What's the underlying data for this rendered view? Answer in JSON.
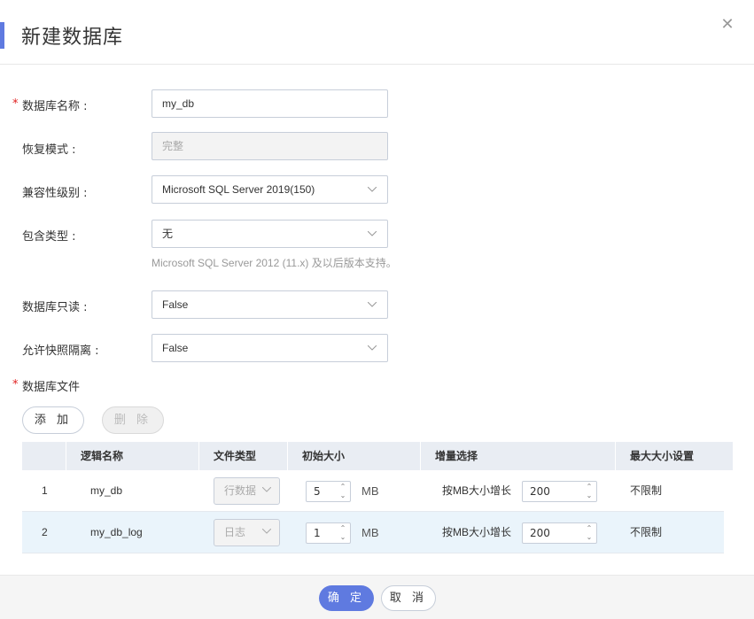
{
  "dialog": {
    "title": "新建数据库",
    "close_glyph": "✕"
  },
  "form": {
    "db_name": {
      "label": "数据库名称 :",
      "required_mark": "*",
      "value": "my_db"
    },
    "recovery_mode": {
      "label": "恢复模式 :",
      "value": "完整"
    },
    "compat_level": {
      "label": "兼容性级别 :",
      "value": "Microsoft SQL Server 2019(150)"
    },
    "containment": {
      "label": "包含类型 :",
      "value": "无",
      "hint": "Microsoft SQL Server 2012 (11.x) 及以后版本支持。"
    },
    "read_only": {
      "label": "数据库只读 :",
      "value": "False"
    },
    "snapshot_isolation": {
      "label": "允许快照隔离 :",
      "value": "False"
    },
    "files": {
      "label": "数据库文件",
      "required_mark": "*"
    }
  },
  "file_actions": {
    "add_label": "添 加",
    "delete_label": "删 除"
  },
  "file_table": {
    "columns": [
      "逻辑名称",
      "文件类型",
      "初始大小",
      "增量选择",
      "最大大小设置"
    ],
    "rows": [
      {
        "index": "1",
        "logical_name": "my_db",
        "file_type": "行数据",
        "initial_size": "5",
        "unit": "MB",
        "growth_label": "按MB大小增长",
        "growth_value": "200",
        "max_size": "不限制"
      },
      {
        "index": "2",
        "logical_name": "my_db_log",
        "file_type": "日志",
        "initial_size": "1",
        "unit": "MB",
        "growth_label": "按MB大小增长",
        "growth_value": "200",
        "max_size": "不限制"
      }
    ]
  },
  "footer": {
    "ok_label": "确 定",
    "cancel_label": "取 消"
  },
  "colors": {
    "accent": "#5f7ae0",
    "required": "#e02020",
    "table_header_bg": "#e9edf3",
    "selected_row_bg": "#eaf4fb"
  },
  "icons": {
    "close": "close-icon",
    "dropdown": "chevron-down-icon",
    "stepper": "stepper-arrows-icon"
  }
}
